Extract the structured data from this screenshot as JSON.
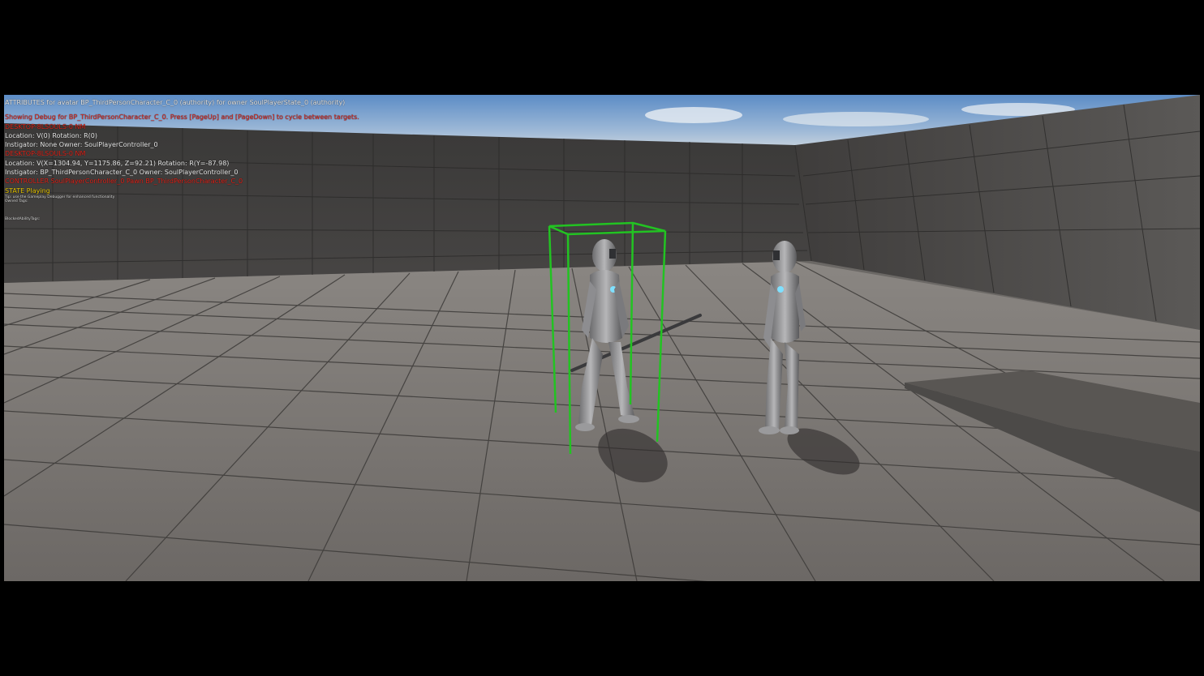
{
  "debug_overlay": {
    "header": "ATTRIBUTES for avatar BP_ThirdPersonCharacter_C_0 (authority) for owner SoulPlayerState_0 (authority)",
    "showing_debug": "Showing Debug for BP_ThirdPersonCharacter_C_0. Press [PageUp] and [PageDown] to cycle between targets.",
    "net_owner_1": "DESKTOP-8LSOULS-0 NM",
    "location_rotation_1": "Location: V(0) Rotation: R(0)",
    "instigator_1": "Instigator: None Owner: SoulPlayerController_0",
    "net_owner_2": "DESKTOP-8LSOULS-0 NM",
    "location_rotation_2": "Location: V(X=1304.94, Y=1175.86, Z=92.21) Rotation: R(Y=-87.98)",
    "instigator_2": "Instigator: BP_ThirdPersonCharacter_C_0 Owner: SoulPlayerController_0",
    "controller": "CONTROLLER SoulPlayerController_0 Pawn BP_ThirdPersonCharacter_C_0",
    "state": "STATE Playing",
    "tip_1": "Tip: use the Gameplay Debugger for enhanced functionality",
    "tip_2": "Owned Tags:",
    "blocked_tags": "BlockedAbilityTags:"
  },
  "colors": {
    "debug_red": "#e0251b",
    "state_yellow": "#e6c400",
    "selection_box_green": "#22c322",
    "sky": "#6f9ccf",
    "floor": "#7b7774"
  }
}
